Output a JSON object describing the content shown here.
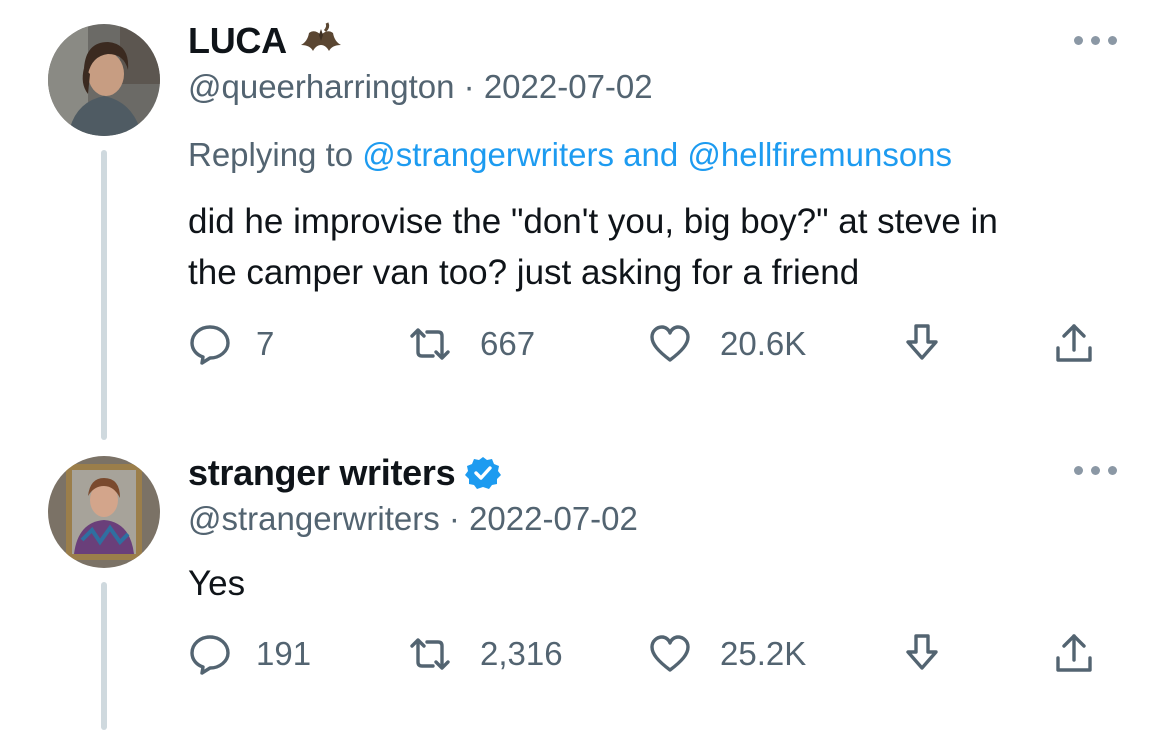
{
  "tweets": [
    {
      "display_name": "LUCA",
      "name_emoji": "bat-emoji",
      "handle": "@queerharrington",
      "separator": " · ",
      "date": "2022-07-02",
      "replying_prefix": "Replying to ",
      "replying_to": [
        "@strangerwriters",
        "@hellfiremunsons"
      ],
      "replying_joiner": " and ",
      "text": "did he improvise the \"don't you, big boy?\" at steve in\nthe camper van too? just asking for a friend",
      "replies": "7",
      "retweets": "667",
      "likes": "20.6K"
    },
    {
      "display_name": "stranger writers",
      "verified": true,
      "handle": "@strangerwriters",
      "separator": " · ",
      "date": "2022-07-02",
      "text": "Yes",
      "replies": "191",
      "retweets": "2,316",
      "likes": "25.2K"
    }
  ],
  "icons": {
    "reply": "speech-bubble-icon",
    "retweet": "retweet-arrows-icon",
    "like": "heart-icon",
    "save": "bookmark-down-arrow-icon",
    "share": "share-upload-icon",
    "more": "more-dots-icon",
    "verified": "verified-badge-icon"
  },
  "colors": {
    "accent": "#1d9bf0",
    "secondary_text": "#536471",
    "thread_line": "#cfd9de"
  }
}
